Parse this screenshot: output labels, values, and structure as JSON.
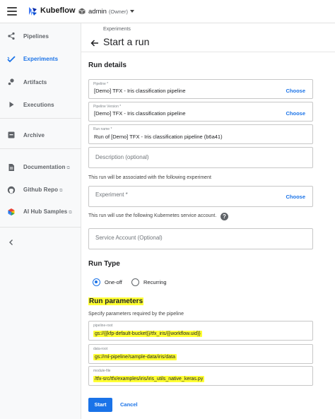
{
  "app": {
    "title": "Kubeflow",
    "namespace": "admin",
    "namespace_role": "(Owner)"
  },
  "sidebar": {
    "items": [
      {
        "label": "Pipelines",
        "icon": "pipelines-icon"
      },
      {
        "label": "Experiments",
        "icon": "experiments-icon",
        "active": true
      },
      {
        "label": "Artifacts",
        "icon": "artifacts-icon"
      },
      {
        "label": "Executions",
        "icon": "executions-icon"
      },
      {
        "label": "Archive",
        "icon": "archive-icon"
      },
      {
        "label": "Documentation",
        "icon": "documentation-icon"
      },
      {
        "label": "Github Repo",
        "icon": "github-icon"
      },
      {
        "label": "AI Hub Samples",
        "icon": "ai-hub-icon"
      }
    ]
  },
  "header": {
    "breadcrumb": "Experiments",
    "title": "Start a run"
  },
  "run_details": {
    "title": "Run details",
    "pipeline": {
      "label": "Pipeline *",
      "value": "[Demo] TFX - Iris classification pipeline",
      "action": "Choose"
    },
    "pipeline_version": {
      "label": "Pipeline Version *",
      "value": "[Demo] TFX - Iris classification pipeline",
      "action": "Choose"
    },
    "run_name": {
      "label": "Run name *",
      "value": "Run of [Demo] TFX - Iris classification pipeline (b6a41)"
    },
    "description": {
      "placeholder": "Description (optional)"
    },
    "experiment_hint": "This run will be associated with the following experiment",
    "experiment": {
      "placeholder": "Experiment *",
      "action": "Choose"
    },
    "service_account_hint": "This run will use the following Kubernetes service account.",
    "service_account": {
      "placeholder": "Service Account (Optional)"
    }
  },
  "run_type": {
    "title": "Run Type",
    "options": [
      {
        "label": "One-off",
        "selected": true
      },
      {
        "label": "Recurring",
        "selected": false
      }
    ]
  },
  "run_parameters": {
    "title": "Run parameters",
    "hint": "Specify parameters required by the pipeline",
    "params": [
      {
        "name": "pipeline-root",
        "value": "gs://{{kfp-default-bucket}}/tfx_iris/{{workflow.uid}}"
      },
      {
        "name": "data-root",
        "value": "gs://ml-pipeline/sample-data/iris/data"
      },
      {
        "name": "module-file",
        "value": "/tfx-src/tfx/examples/iris/iris_utils_native_keras.py"
      }
    ]
  },
  "actions": {
    "start": "Start",
    "cancel": "Cancel"
  },
  "colors": {
    "accent": "#1a73e8",
    "highlight": "#ffff33"
  }
}
